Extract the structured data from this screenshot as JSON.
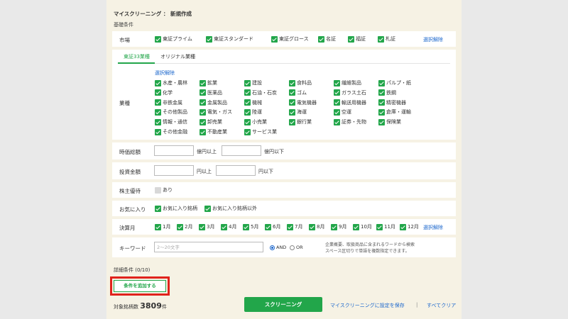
{
  "title": "マイスクリーニング ： 新規作成",
  "subtitle": "基礎条件",
  "market": {
    "label": "市場",
    "options": [
      "東証プライム",
      "東証スタンダード",
      "東証グロース",
      "名証",
      "福証",
      "札証"
    ],
    "deselect": "選択解除"
  },
  "industry": {
    "tabs": [
      "東証33業種",
      "オリジナル業種"
    ],
    "deselect": "選択解除",
    "label": "業種",
    "items": [
      "水産・農林",
      "鉱業",
      "建設",
      "食料品",
      "繊維製品",
      "パルプ・紙",
      "化学",
      "医薬品",
      "石油・石炭",
      "ゴム",
      "ガラス土石",
      "鉄鋼",
      "非鉄金属",
      "金属製品",
      "機械",
      "電気機器",
      "輸送用機器",
      "精密機器",
      "その他製品",
      "電気・ガス",
      "陸運",
      "海運",
      "空運",
      "倉庫・運輸",
      "情報・通信",
      "卸売業",
      "小売業",
      "銀行業",
      "証券・先物",
      "保険業",
      "その他金融",
      "不動産業",
      "サービス業"
    ]
  },
  "market_cap": {
    "label": "時価総額",
    "unit_min": "億円以上",
    "unit_max": "億円以下"
  },
  "investment": {
    "label": "投資金額",
    "unit_min": "円以上",
    "unit_max": "円以下"
  },
  "benefit": {
    "label": "株主優待",
    "option": "あり"
  },
  "favorites": {
    "label": "お気に入り",
    "options": [
      "お気に入り銘柄",
      "お気に入り銘柄以外"
    ]
  },
  "fiscal": {
    "label": "決算月",
    "months": [
      "1月",
      "2月",
      "3月",
      "4月",
      "5月",
      "6月",
      "7月",
      "8月",
      "9月",
      "10月",
      "11月",
      "12月"
    ],
    "deselect": "選択解除"
  },
  "keyword": {
    "label": "キーワード",
    "placeholder": "2～20文字",
    "and": "AND",
    "or": "OR",
    "hint1": "企業概要、取扱商品に含まれるワードから検索",
    "hint2": "スペース区切りで単語を複数指定できます。"
  },
  "detail": {
    "label": "詳細条件 (0/10)",
    "add_button": "条件を追加する"
  },
  "footer": {
    "count_label": "対象銘柄数",
    "count": "3809",
    "count_unit": "件",
    "screening": "スクリーニング",
    "save": "マイスクリーニングに設定を保存",
    "separator": "|",
    "clear": "すべてクリア"
  },
  "colors": {
    "accent": "#22a64a",
    "link": "#1a66cc",
    "highlight": "#e0231c",
    "panel": "#f6f2e4"
  }
}
